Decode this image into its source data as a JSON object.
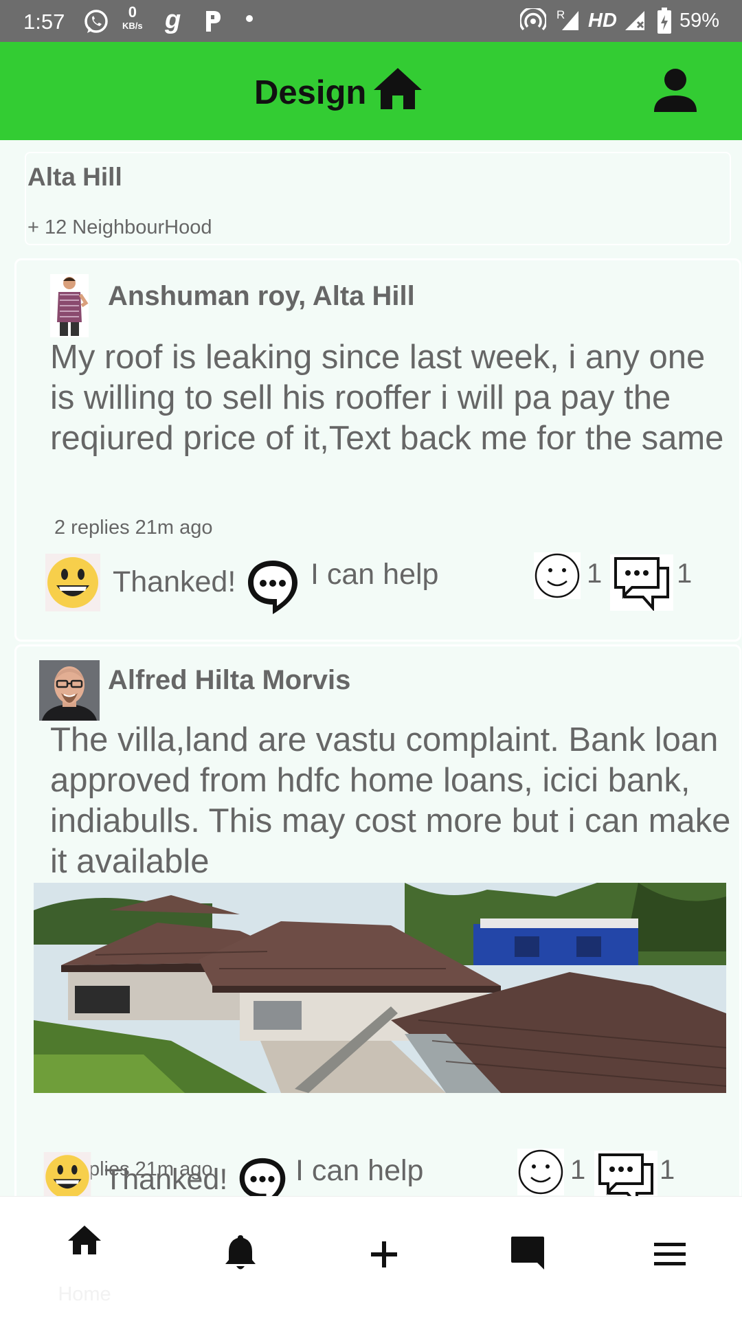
{
  "status_bar": {
    "time": "1:57",
    "net_speed_value": "0",
    "net_speed_unit": "KB/s",
    "network_label": "HD",
    "roaming_label": "R",
    "battery": "59%"
  },
  "app_bar": {
    "title": "Design",
    "color": "#33cc33"
  },
  "neighbourhood": {
    "name": "Alta Hill",
    "extra": "+ 12 NeighbourHood"
  },
  "posts": [
    {
      "author": "Anshuman roy, Alta Hill",
      "text": "My roof is leaking since last week, i any one is willing to sell his rooffer i will pa pay the reqiured price of it,Text back me for the same",
      "meta": "2 replies 21m ago",
      "thank_label": "Thanked!",
      "help_label": "I can help",
      "smile_count": "1",
      "comment_count": "1"
    },
    {
      "author": "Alfred Hilta Morvis",
      "text": "The villa,land are vastu complaint. Bank loan approved from hdfc home loans, icici bank, indiabulls. This may cost more but i can make it available",
      "meta": "2 replies 21m ago",
      "thank_label": "Thanked!",
      "help_label": "I can help",
      "smile_count": "1",
      "comment_count": "1"
    }
  ],
  "bottom_nav": {
    "home_label": "Home",
    "icons": [
      "home-icon",
      "bell-icon",
      "plus-icon",
      "chat-icon",
      "menu-icon"
    ]
  }
}
